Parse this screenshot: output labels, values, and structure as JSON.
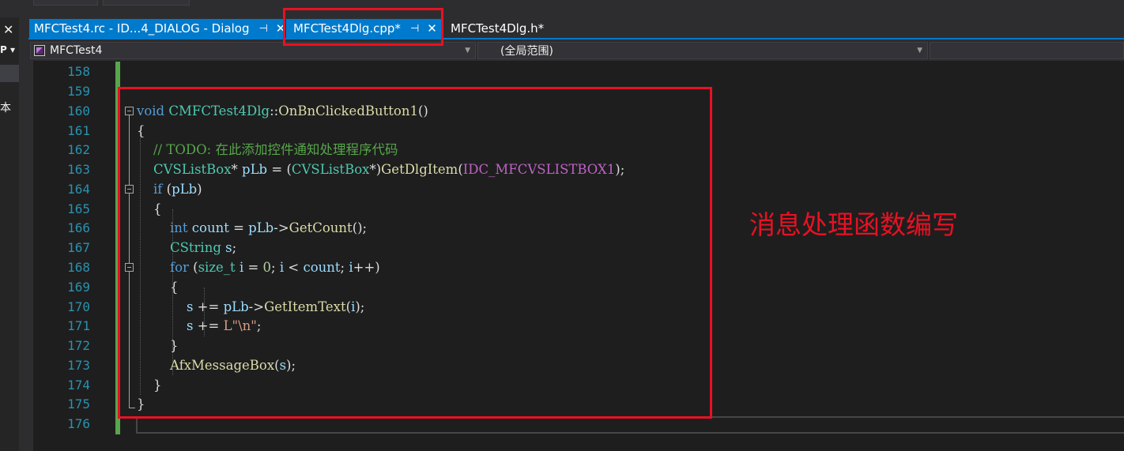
{
  "left_panel": {
    "close_glyph": "✕",
    "pin_glyph": "P ▾",
    "partial_char": "本"
  },
  "tabs": [
    {
      "label": "MFCTest4.rc - ID...4_DIALOG - Dialog",
      "pin": "⊣",
      "close": "✕",
      "active": true
    },
    {
      "label": "MFCTest4Dlg.cpp*",
      "pin": "⊣",
      "close": "✕",
      "active": true
    },
    {
      "label": "MFCTest4Dlg.h*",
      "active": false
    }
  ],
  "nav": {
    "project": "MFCTest4",
    "scope": "(全局范围)",
    "dropdown_arrow": "▼"
  },
  "editor": {
    "line_numbers": [
      "158",
      "159",
      "160",
      "161",
      "162",
      "163",
      "164",
      "165",
      "166",
      "167",
      "168",
      "169",
      "170",
      "171",
      "172",
      "173",
      "174",
      "175",
      "176"
    ],
    "code_lines": [
      "",
      "",
      "void CMFCTest4Dlg::OnBnClickedButton1()",
      "{",
      "    // TODO: 在此添加控件通知处理程序代码",
      "    CVSListBox* pLb = (CVSListBox*)GetDlgItem(IDC_MFCVSLISTBOX1);",
      "    if (pLb)",
      "    {",
      "        int count = pLb->GetCount();",
      "        CString s;",
      "        for (size_t i = 0; i < count; i++)",
      "        {",
      "            s += pLb->GetItemText(i);",
      "            s += L\"\\n\";",
      "        }",
      "        AfxMessageBox(s);",
      "    }",
      "}",
      ""
    ]
  },
  "annotation": {
    "text": "消息处理函数编写",
    "color": "#e81123"
  },
  "colors": {
    "accent": "#007acc",
    "editor_bg": "#1e1e1e",
    "keyword": "#569cd6",
    "type": "#4ec9b0",
    "function": "#dcdcaa",
    "variable": "#9cdcfe",
    "comment": "#57a64a",
    "macro": "#bd63c5",
    "line_number": "#2b91af",
    "annotation_red": "#e81123"
  }
}
